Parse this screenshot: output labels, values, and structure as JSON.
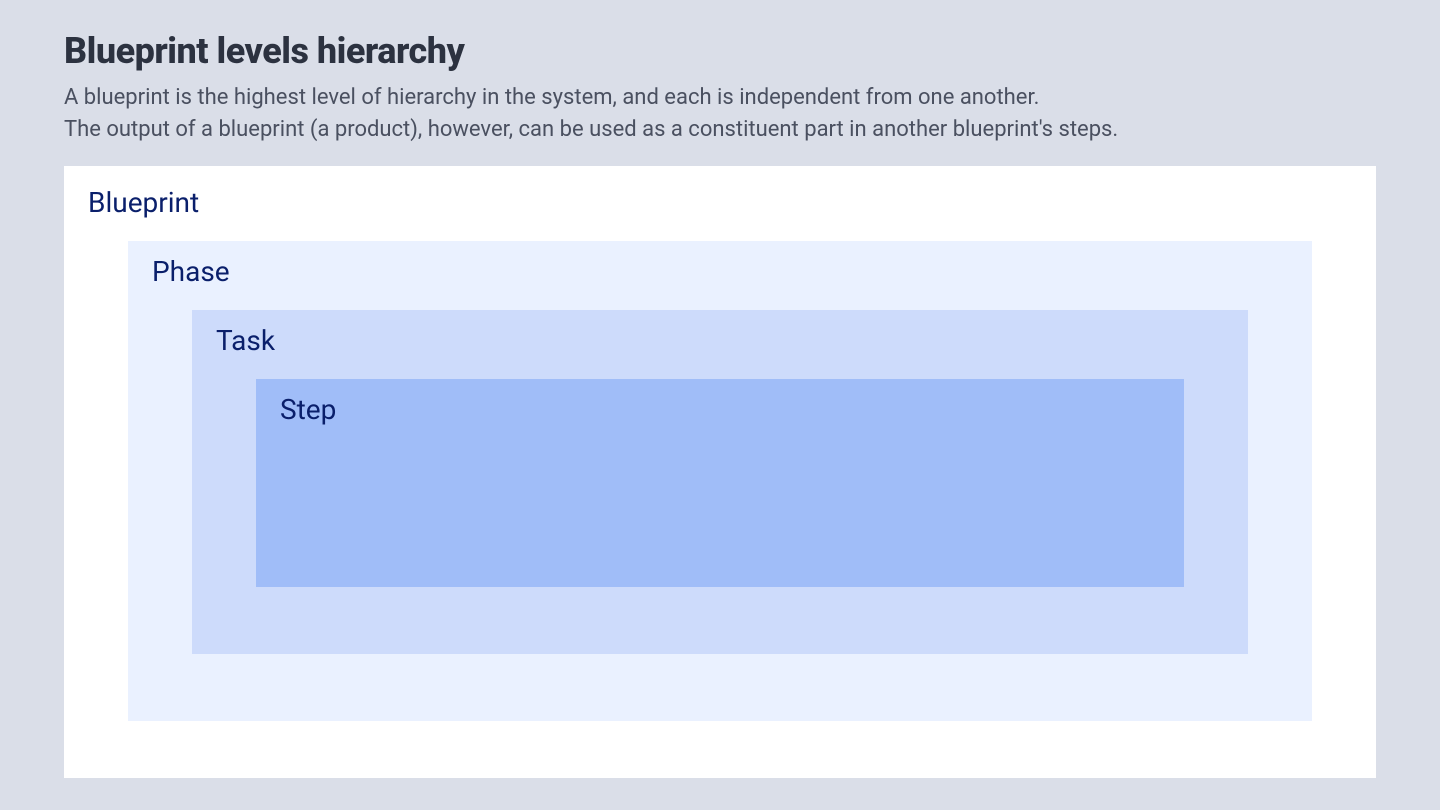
{
  "title": "Blueprint levels hierarchy",
  "description_line1": "A blueprint is the highest level of hierarchy in the system, and each is independent from one another.",
  "description_line2": "The output of a blueprint (a product), however, can be used as a constituent part in another blueprint's steps.",
  "hierarchy": {
    "level1": "Blueprint",
    "level2": "Phase",
    "level3": "Task",
    "level4": "Step"
  },
  "colors": {
    "background": "#dadee8",
    "blueprint_bg": "#ffffff",
    "phase_bg": "#eaf1ff",
    "task_bg": "#cddbfb",
    "step_bg": "#a0bdf8",
    "label_color": "#0a1f6b",
    "title_color": "#2c3240",
    "description_color": "#4a5060"
  }
}
